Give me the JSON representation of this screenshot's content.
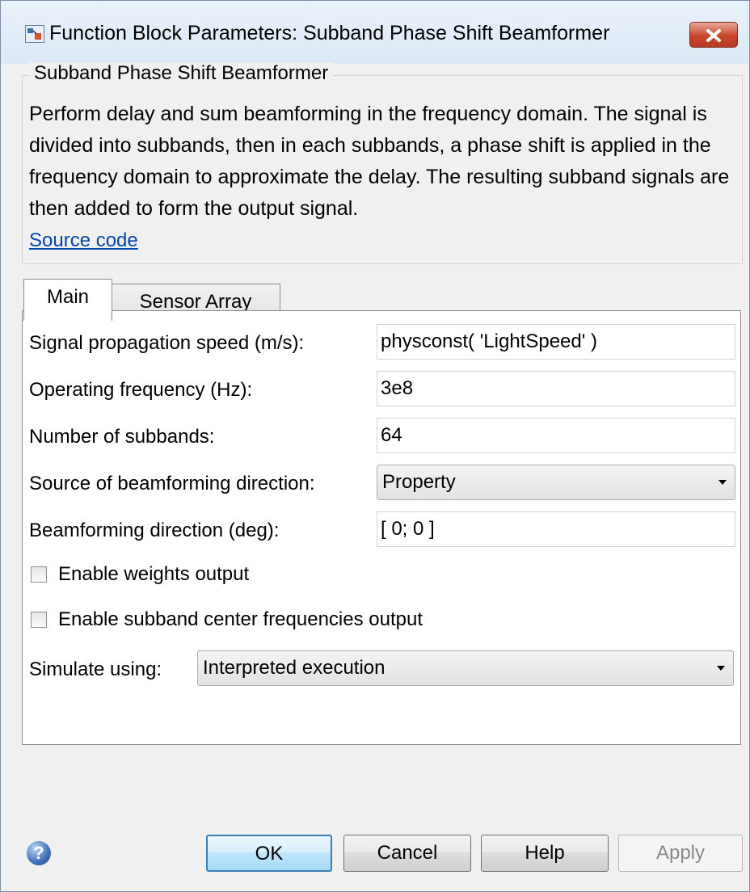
{
  "window": {
    "title": "Function Block Parameters: Subband Phase Shift Beamformer"
  },
  "group": {
    "title": "Subband Phase Shift Beamformer",
    "description": "Perform delay and sum beamforming in the frequency domain. The signal is divided into subbands, then in each subbands, a phase shift is applied in the frequency domain to approximate the delay. The resulting subband signals are then added to form the output signal.",
    "source_link": "Source code"
  },
  "tabs": [
    {
      "label": "Main"
    },
    {
      "label": "Sensor Array"
    }
  ],
  "fields": {
    "propagation_speed": {
      "label": "Signal propagation speed (m/s):",
      "value": "physconst( 'LightSpeed' )"
    },
    "operating_frequency": {
      "label": "Operating frequency (Hz):",
      "value": "3e8"
    },
    "num_subbands": {
      "label": "Number of subbands:",
      "value": "64"
    },
    "direction_source": {
      "label": "Source of beamforming direction:",
      "value": "Property"
    },
    "beam_direction": {
      "label": "Beamforming direction (deg):",
      "value": "[ 0; 0 ]"
    },
    "weights_output": {
      "label": "Enable weights output",
      "checked": false
    },
    "center_freq_output": {
      "label": "Enable subband center frequencies output",
      "checked": false
    },
    "simulate_using": {
      "label": "Simulate using:",
      "value": "Interpreted execution"
    }
  },
  "buttons": {
    "ok": "OK",
    "cancel": "Cancel",
    "help": "Help",
    "apply": "Apply"
  },
  "icons": {
    "app": "simulink-block-icon",
    "close": "close-icon",
    "help": "help-icon"
  }
}
